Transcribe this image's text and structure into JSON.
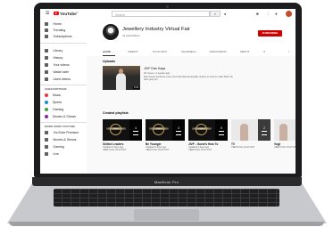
{
  "laptop": {
    "model_label": "MacBook Pro"
  },
  "topbar": {
    "logo": "YouTube",
    "logo_suffix": "IN",
    "search_placeholder": "Search",
    "menu_icon": "hamburger-icon",
    "search_icon": "search-icon",
    "mic_icon": "mic-icon"
  },
  "sidebar": {
    "primary": [
      {
        "label": "Home",
        "icon": "home-icon"
      },
      {
        "label": "Trending",
        "icon": "trending-icon"
      },
      {
        "label": "Subscriptions",
        "icon": "subscriptions-icon"
      }
    ],
    "library": [
      {
        "label": "Library",
        "icon": "library-icon"
      },
      {
        "label": "History",
        "icon": "history-icon"
      },
      {
        "label": "Your videos",
        "icon": "your-videos-icon"
      },
      {
        "label": "Watch later",
        "icon": "watch-later-icon"
      },
      {
        "label": "Liked videos",
        "icon": "liked-videos-icon"
      }
    ],
    "subscriptions_heading": "SUBSCRIPTIONS",
    "subscriptions": [
      {
        "label": "Music",
        "color": "#e53935"
      },
      {
        "label": "Sports",
        "color": "#1e88e5"
      },
      {
        "label": "Gaming",
        "color": "#43a047"
      },
      {
        "label": "Movies & Shows",
        "color": "#8e24aa"
      }
    ],
    "more_heading": "MORE FROM YOUTUBE",
    "more": [
      {
        "label": "YouTube Premium",
        "icon": "youtube-premium-icon"
      },
      {
        "label": "Movies & Shows",
        "icon": "movies-icon"
      },
      {
        "label": "Gaming",
        "icon": "gaming-icon"
      },
      {
        "label": "Live",
        "icon": "live-icon"
      }
    ]
  },
  "channel": {
    "title": "Jewellery Industry Virtual Fair",
    "subscribers": "41 subscribers",
    "subscribe_label": "SUBSCRIBE",
    "tabs": [
      "HOME",
      "VIDEOS",
      "PLAYLISTS",
      "CHANNELS",
      "DISCUSSION",
      "ABOUT"
    ],
    "active_tab": "HOME"
  },
  "uploads": {
    "heading": "Uploads",
    "video": {
      "title": "JIVF Dan Kaya",
      "meta": "26 views • 4 weeks ago",
      "description": "Dan Kaya's exclusive event and international speaker shares on how to make 2021 the best year yet!",
      "duration": "6:04"
    }
  },
  "playlists": {
    "heading": "Created playlists",
    "items": [
      {
        "title": "Skilled Leaders",
        "meta": "Updated 3 days ago",
        "link": "VIEW FULL PLAYLIST",
        "count": "4",
        "theme": "dark"
      },
      {
        "title": "Be Younger",
        "meta": "Updated 3 days ago",
        "link": "VIEW FULL PLAYLIST",
        "count": "3",
        "theme": "dark"
      },
      {
        "title": "JIVF - Guest's How To",
        "meta": "Updated 3 days ago",
        "link": "VIEW FULL PLAYLIST",
        "count": "5",
        "theme": "dark"
      },
      {
        "title": "TV",
        "meta": "VIEW FULL PLAYLIST",
        "link": "",
        "count": "2",
        "theme": "light"
      },
      {
        "title": "Vogt",
        "meta": "VIEW FULL PLAYLIST",
        "link": "",
        "count": "3",
        "theme": "light"
      }
    ]
  }
}
